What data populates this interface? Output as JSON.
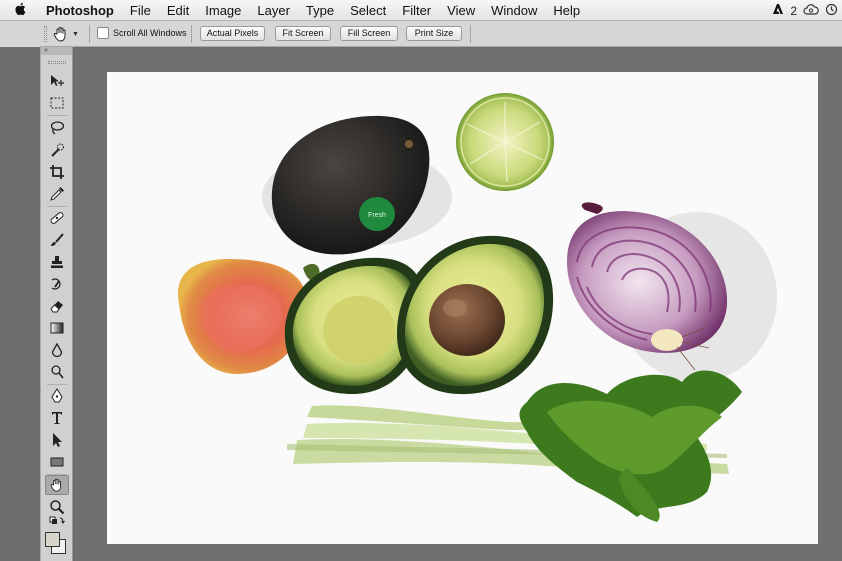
{
  "menubar": {
    "app_name": "Photoshop",
    "items": [
      "File",
      "Edit",
      "Image",
      "Layer",
      "Type",
      "Select",
      "Filter",
      "View",
      "Window",
      "Help"
    ],
    "status_count": "2"
  },
  "options_bar": {
    "checkbox_label": "Scroll All Windows",
    "checkbox_checked": false,
    "buttons": [
      "Actual Pixels",
      "Fit Screen",
      "Fill Screen",
      "Print Size"
    ]
  },
  "toolbox": {
    "header": "»",
    "tools": [
      "move-tool",
      "marquee-tool",
      "lasso-tool",
      "quick-select-tool",
      "crop-tool",
      "eyedropper-tool",
      "healing-brush-tool",
      "brush-tool",
      "clone-stamp-tool",
      "history-brush-tool",
      "eraser-tool",
      "gradient-tool",
      "blur-tool",
      "dodge-tool",
      "pen-tool",
      "type-tool",
      "path-select-tool",
      "rectangle-tool",
      "hand-tool",
      "zoom-tool"
    ],
    "active_tool": "hand-tool",
    "foreground_color": "#d8d4cc",
    "background_color": "#f2f2f2"
  },
  "document": {
    "sticker_text": "Fresh"
  },
  "colors": {
    "menubar": "#ececec",
    "options_bar": "#d6d6d6",
    "pasteboard": "#707070"
  }
}
